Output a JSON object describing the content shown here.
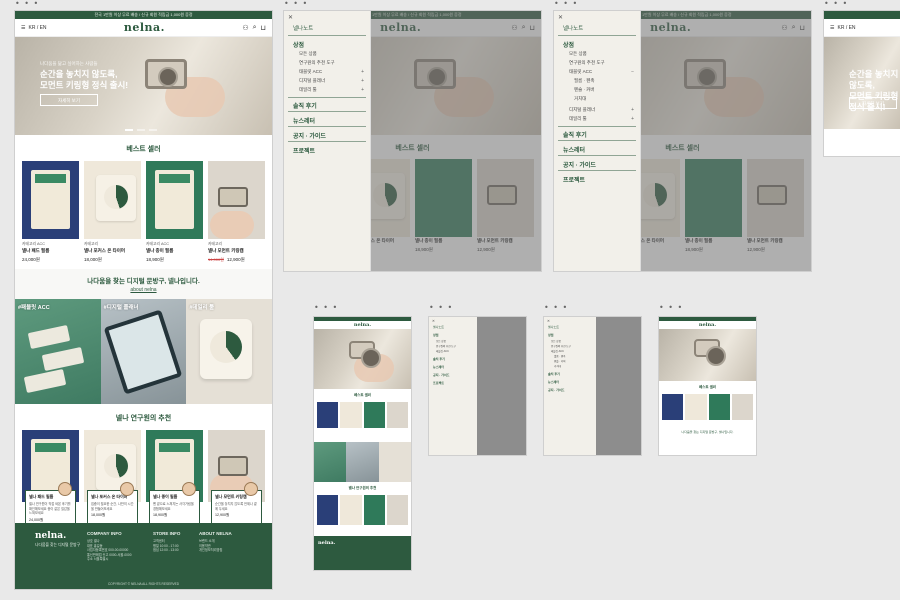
{
  "frames": {
    "dots": "• • •"
  },
  "topbar": {
    "notice": "전국 1만원 이상 무료 배송 / 신규 회원 적립금 1,000원 증정"
  },
  "header": {
    "logo": "nelna.",
    "lang": "KR / EN",
    "icons": [
      "menu-icon",
      "user-icon",
      "search-icon",
      "cart-icon"
    ]
  },
  "hero": {
    "tagline": "나다움을 닮고 싶어하는 사람들",
    "headline_line1": "순간을 놓치지 않도록,",
    "headline_line2": "모먼트 키링형 정식 출시!",
    "cta": "자세히 보기"
  },
  "best": {
    "title": "베스트 셀러",
    "products": [
      {
        "cat": "카테고리 ACC",
        "name": "넬나 패드 필름",
        "old": "",
        "price": "24,000원"
      },
      {
        "cat": "카테고리",
        "name": "넬나 포커스 온 타이머",
        "old": "",
        "price": "18,000원"
      },
      {
        "cat": "카테고리 ACC",
        "name": "넬나 종이 필름",
        "old": "",
        "price": "18,900원"
      },
      {
        "cat": "카테고리",
        "name": "넬나 모먼트 키링캠",
        "old": "14,900원",
        "price": "12,900원"
      }
    ]
  },
  "brand": {
    "text": "나다움을 찾는 디지털 문방구, 넬나입니다.",
    "link": "about nelna"
  },
  "categories": [
    {
      "label": "#패블릿 ACC"
    },
    {
      "label": "#디지털 플래너"
    },
    {
      "label": "#데일리 툴"
    }
  ],
  "recs": {
    "title": "넬나 연구원의 추천",
    "items": [
      {
        "title": "넬나 패드 필름",
        "desc": "넬나 연구원이 직접 써본 후기를 확인해보세요 종이 같은 질감을 느껴보세요",
        "price": "24,000원"
      },
      {
        "title": "넬나 포커스 온 타이머",
        "desc": "집중이 필요한 순간, 나만의 시간을 만들어보세요",
        "price": "18,000원"
      },
      {
        "title": "넬나 종이 필름",
        "desc": "펜 끝으로 느껴지는 사각거림을 경험해보세요",
        "price": "18,900원"
      },
      {
        "title": "넬나 모먼트 키링캠",
        "desc": "순간을 놓치지 않도록 언제나 곁에 두세요",
        "price": "12,900원"
      }
    ]
  },
  "footer": {
    "logo": "nelna.",
    "tagline": "나다움을 찾는 디지털 문방구",
    "cols": [
      {
        "title": "COMPANY INFO",
        "lines": [
          "상호 넬나",
          "대표 홍길동",
          "사업자등록번호 000-00-00000",
          "통신판매업 신고 0000-서울-0000",
          "주소 서울특별시"
        ]
      },
      {
        "title": "STORE INFO",
        "lines": [
          "고객센터",
          "평일 10:00 - 17:00",
          "점심 12:00 - 13:00"
        ]
      },
      {
        "title": "ABOUT NELNA",
        "lines": [
          "브랜드 소개",
          "이용약관",
          "개인정보처리방침"
        ]
      }
    ],
    "copyright": "COPYRIGHT © NELNA ALL RIGHTS RESERVED"
  },
  "drawer_closed": {
    "greet": "넬나노트",
    "shop": "상점",
    "sub": [
      "모든 상품",
      "연구원의 추천 도구",
      "태블릿 ACC",
      "디지털 플래너",
      "데일리 툴"
    ],
    "review": "솔직 후기",
    "news": "뉴스레터",
    "notice": "공지 · 가이드",
    "project": "프로젝트"
  },
  "drawer_open": {
    "greet": "넬나노트",
    "shop": "상점",
    "sub": [
      "모든 상품",
      "연구원의 추천 도구",
      "태블릿 ACC",
      "필름 · 펜촉",
      "펜슬 · 커버",
      "거치대",
      "디지털 플래너",
      "데일리 툴"
    ],
    "review": "솔직 후기",
    "news": "뉴스레터",
    "notice": "공지 · 가이드",
    "project": "프로젝트"
  },
  "colors": {
    "brand_green": "#2d5a3f",
    "overlay": "#6e6e6e"
  }
}
